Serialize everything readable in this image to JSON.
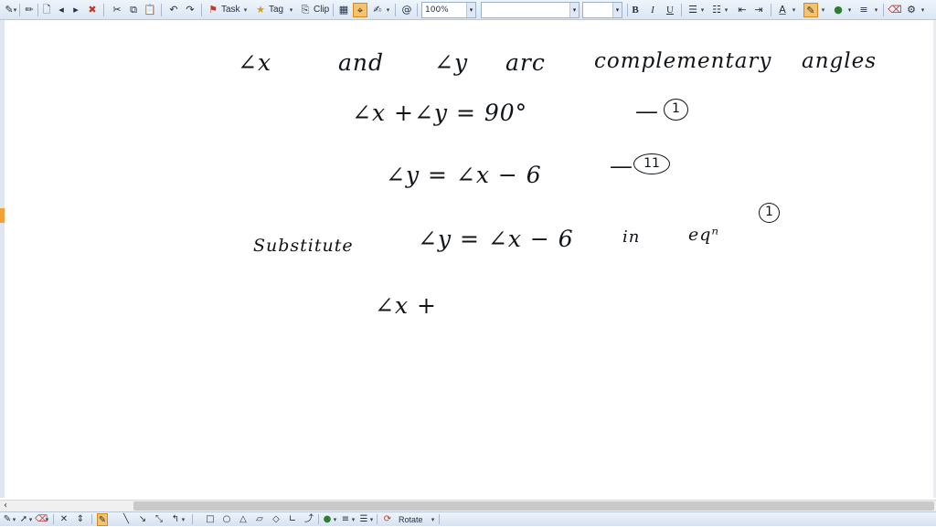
{
  "toolbar": {
    "task_label": "Task",
    "tag_label": "Tag",
    "clip_label": "Clip",
    "zoom_value": "100%",
    "font_name_value": "",
    "font_size_value": "",
    "bold_label": "B",
    "italic_label": "I",
    "underline_label": "U",
    "icons": [
      "pen-icon",
      "new-page-icon",
      "previous-page-icon",
      "next-page-icon",
      "delete-page-icon",
      "cut-icon",
      "copy-icon",
      "paste-icon",
      "undo-icon",
      "redo-icon",
      "task-flag-icon",
      "tag-star-icon",
      "clip-icon",
      "table-icon",
      "lasso-icon",
      "highlighter-icon",
      "at-icon",
      "bullets-icon",
      "numbering-icon",
      "decrease-indent-icon",
      "increase-indent-icon",
      "font-color-icon",
      "highlight-color-icon",
      "color-picker-icon",
      "line-style-icon",
      "eraser-icon",
      "options-icon"
    ]
  },
  "notes": {
    "line1": {
      "x": "∠x",
      "and": "and",
      "y": "∠y",
      "are": "arc",
      "complementary": "complementary",
      "angles": "angles"
    },
    "line2": {
      "text": "∠x  +∠y  =  90°",
      "ref": "—",
      "ref_num": "1"
    },
    "line3": {
      "text": "∠y  =  ∠x  − 6",
      "ref": "—",
      "ref_num": "11"
    },
    "line4": {
      "word": "Substitute",
      "expr": "∠y  =  ∠x − 6",
      "in": "in",
      "eqn": "eqⁿ",
      "ref_num": "1"
    },
    "line5": {
      "text": "∠x  +"
    }
  },
  "bottombar": {
    "rotate_label": "Rotate",
    "icons": [
      "pen-tool-icon",
      "pointer-icon",
      "eraser-tool-icon",
      "close-icon",
      "insert-space-icon",
      "highlighter-tool-icon",
      "line-icon",
      "arrow-line-icon",
      "double-arrow-icon",
      "axis-icon",
      "rectangle-icon",
      "ellipse-icon",
      "triangle-icon",
      "parallelogram-icon",
      "diamond-icon",
      "axes-icon",
      "arrow-icon",
      "color-icon",
      "thickness-icon",
      "line-style-tool-icon",
      "rotate-icon"
    ]
  },
  "colors": {
    "toolbar_bg": "#dbe6f3",
    "accent": "#f3a03b",
    "ink": "#101418"
  }
}
